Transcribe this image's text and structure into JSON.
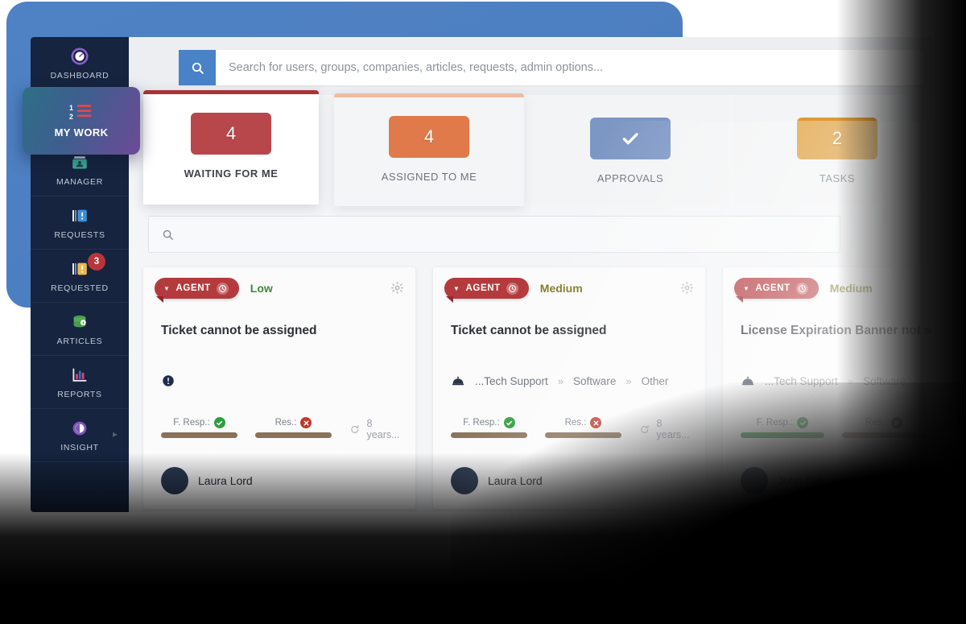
{
  "sidebar": {
    "items": [
      {
        "label": "DASHBOARD",
        "icon": "gauge-icon",
        "badge": null
      },
      {
        "label": "MY WORK",
        "icon": "ordered-list-icon",
        "badge": null,
        "active": true
      },
      {
        "label": "MANAGER",
        "icon": "group-manager-icon",
        "badge": null
      },
      {
        "label": "REQUESTS",
        "icon": "requests-icon",
        "badge": null
      },
      {
        "label": "REQUESTED",
        "icon": "requested-icon",
        "badge": "3"
      },
      {
        "label": "ARTICLES",
        "icon": "database-info-icon",
        "badge": null
      },
      {
        "label": "REPORTS",
        "icon": "bar-chart-icon",
        "badge": null
      },
      {
        "label": "INSIGHT",
        "icon": "insight-icon",
        "badge": null,
        "has_submenu": true
      }
    ]
  },
  "search": {
    "placeholder": "Search for users, groups, companies, articles, requests, admin options...",
    "value": "",
    "icon": "search-icon"
  },
  "inner_search": {
    "placeholder": "",
    "value": "",
    "icon": "search-icon"
  },
  "stats": [
    {
      "value": "4",
      "label": "WAITING FOR ME",
      "color": "#b8474b",
      "accent": "#a83438",
      "state": "active"
    },
    {
      "value": "4",
      "label": "ASSIGNED TO ME",
      "color": "#e07a4b",
      "accent": "#edbda2",
      "state": "raised"
    },
    {
      "value": "",
      "label": "APPROVALS",
      "color": "#7d97c4",
      "accent": "#aebdd6",
      "state": "normal",
      "icon": "check-icon"
    },
    {
      "value": "2",
      "label": "TASKS",
      "color": "#dd9b35",
      "accent": "#e8c188",
      "state": "normal"
    }
  ],
  "tickets": [
    {
      "flag": "AGENT",
      "flag_icon": "clock-icon",
      "priority": "Low",
      "priority_level": "low",
      "gear_icon": "gear-icon",
      "title": "Ticket cannot be assigned",
      "meta_icon": "alert-icon",
      "breadcrumb": [],
      "sla": [
        {
          "label": "F. Resp.:",
          "status": "ok",
          "bar": "brown"
        },
        {
          "label": "Res.:",
          "status": "bad",
          "bar": "brown"
        }
      ],
      "age": "8 years...",
      "age_icon": "refresh-icon",
      "user": "Laura Lord",
      "avatar_icon": "avatar"
    },
    {
      "flag": "AGENT",
      "flag_icon": "clock-icon",
      "priority": "Medium",
      "priority_level": "medium",
      "gear_icon": "gear-icon",
      "title": "Ticket cannot be assigned",
      "meta_icon": "service-bell-icon",
      "breadcrumb": [
        "...Tech Support",
        "Software",
        "Other"
      ],
      "sla": [
        {
          "label": "F. Resp.:",
          "status": "ok",
          "bar": "brown"
        },
        {
          "label": "Res.:",
          "status": "bad",
          "bar": "brown"
        }
      ],
      "age": "8 years...",
      "age_icon": "refresh-icon",
      "user": "Laura Lord",
      "avatar_icon": "avatar"
    },
    {
      "flag": "AGENT",
      "flag_icon": "clock-icon",
      "priority": "Medium",
      "priority_level": "medium",
      "gear_icon": "gear-icon",
      "title": "License Expiration Banner not showing",
      "meta_icon": "service-bell-icon",
      "breadcrumb": [
        "...Tech Support",
        "Software"
      ],
      "sla": [
        {
          "label": "F. Resp.:",
          "status": "ok",
          "bar": "green"
        },
        {
          "label": "Res.:",
          "status": "bad-dark",
          "bar": "brown"
        }
      ],
      "age": "",
      "age_icon": "refresh-icon",
      "user": "John Sykes",
      "avatar_icon": "avatar"
    }
  ],
  "colors": {
    "sidebar_bg": "#16243f",
    "accent_blue": "#4a82c8",
    "flag_red": "#b53a3e",
    "backdrop_blue": "#4a7fc1"
  }
}
